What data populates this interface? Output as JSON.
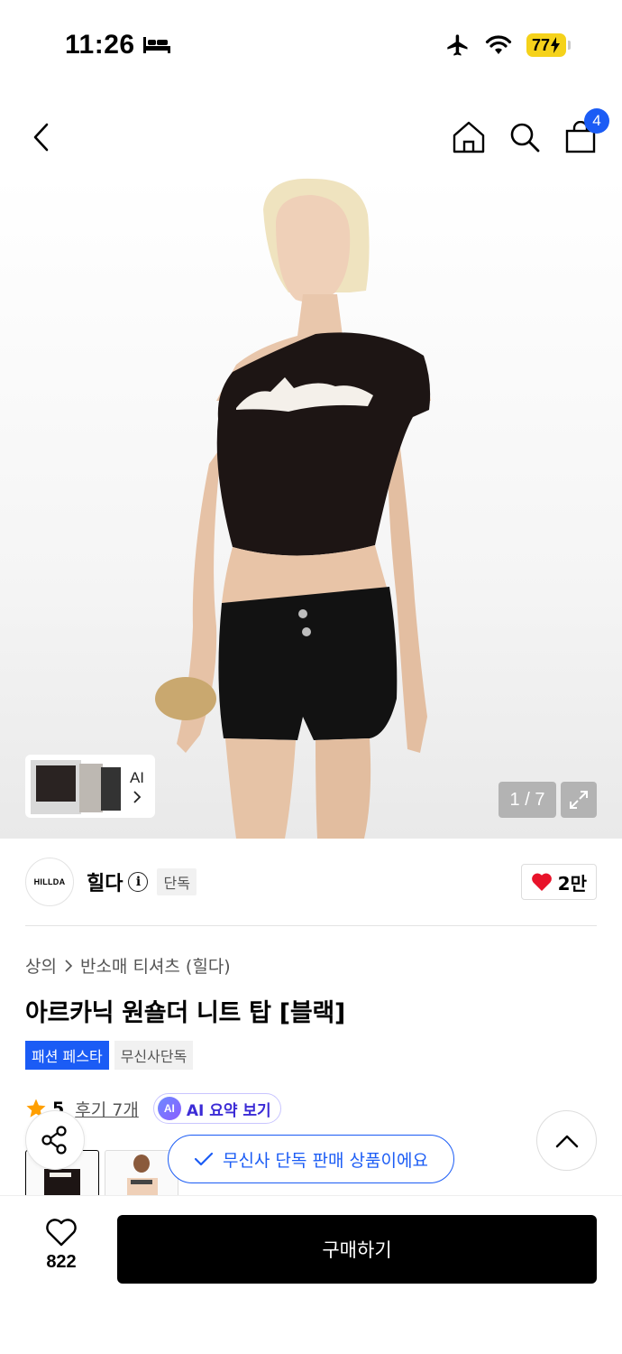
{
  "status_bar": {
    "time": "11:26",
    "battery": "77"
  },
  "nav": {
    "cart_count": "4"
  },
  "gallery": {
    "thumb_ai_label": "AI",
    "counter": "1 / 7"
  },
  "brand": {
    "logo_text": "HILLDA",
    "name": "힐다",
    "exclusive_tag": "단독",
    "likes": "2만"
  },
  "breadcrumb": [
    "상의",
    "반소매 티셔츠 (힐다)"
  ],
  "product": {
    "title": "아르카닉 원숄더 니트 탑 [블랙]",
    "tags": [
      "패션 페스타",
      "무신사단독"
    ],
    "rating": "5",
    "review_link": "후기 7개",
    "ai_badge": "AI",
    "ai_summary": "AI 요약 보기"
  },
  "toast": {
    "text": "무신사 단독 판매 상품이에요"
  },
  "bottom_bar": {
    "wish_count": "822",
    "buy_label": "구매하기"
  },
  "colors": {
    "accent": "#1b5cf5",
    "heart": "#e8132a",
    "star": "#ff9f00",
    "battery": "#f5d21a"
  }
}
